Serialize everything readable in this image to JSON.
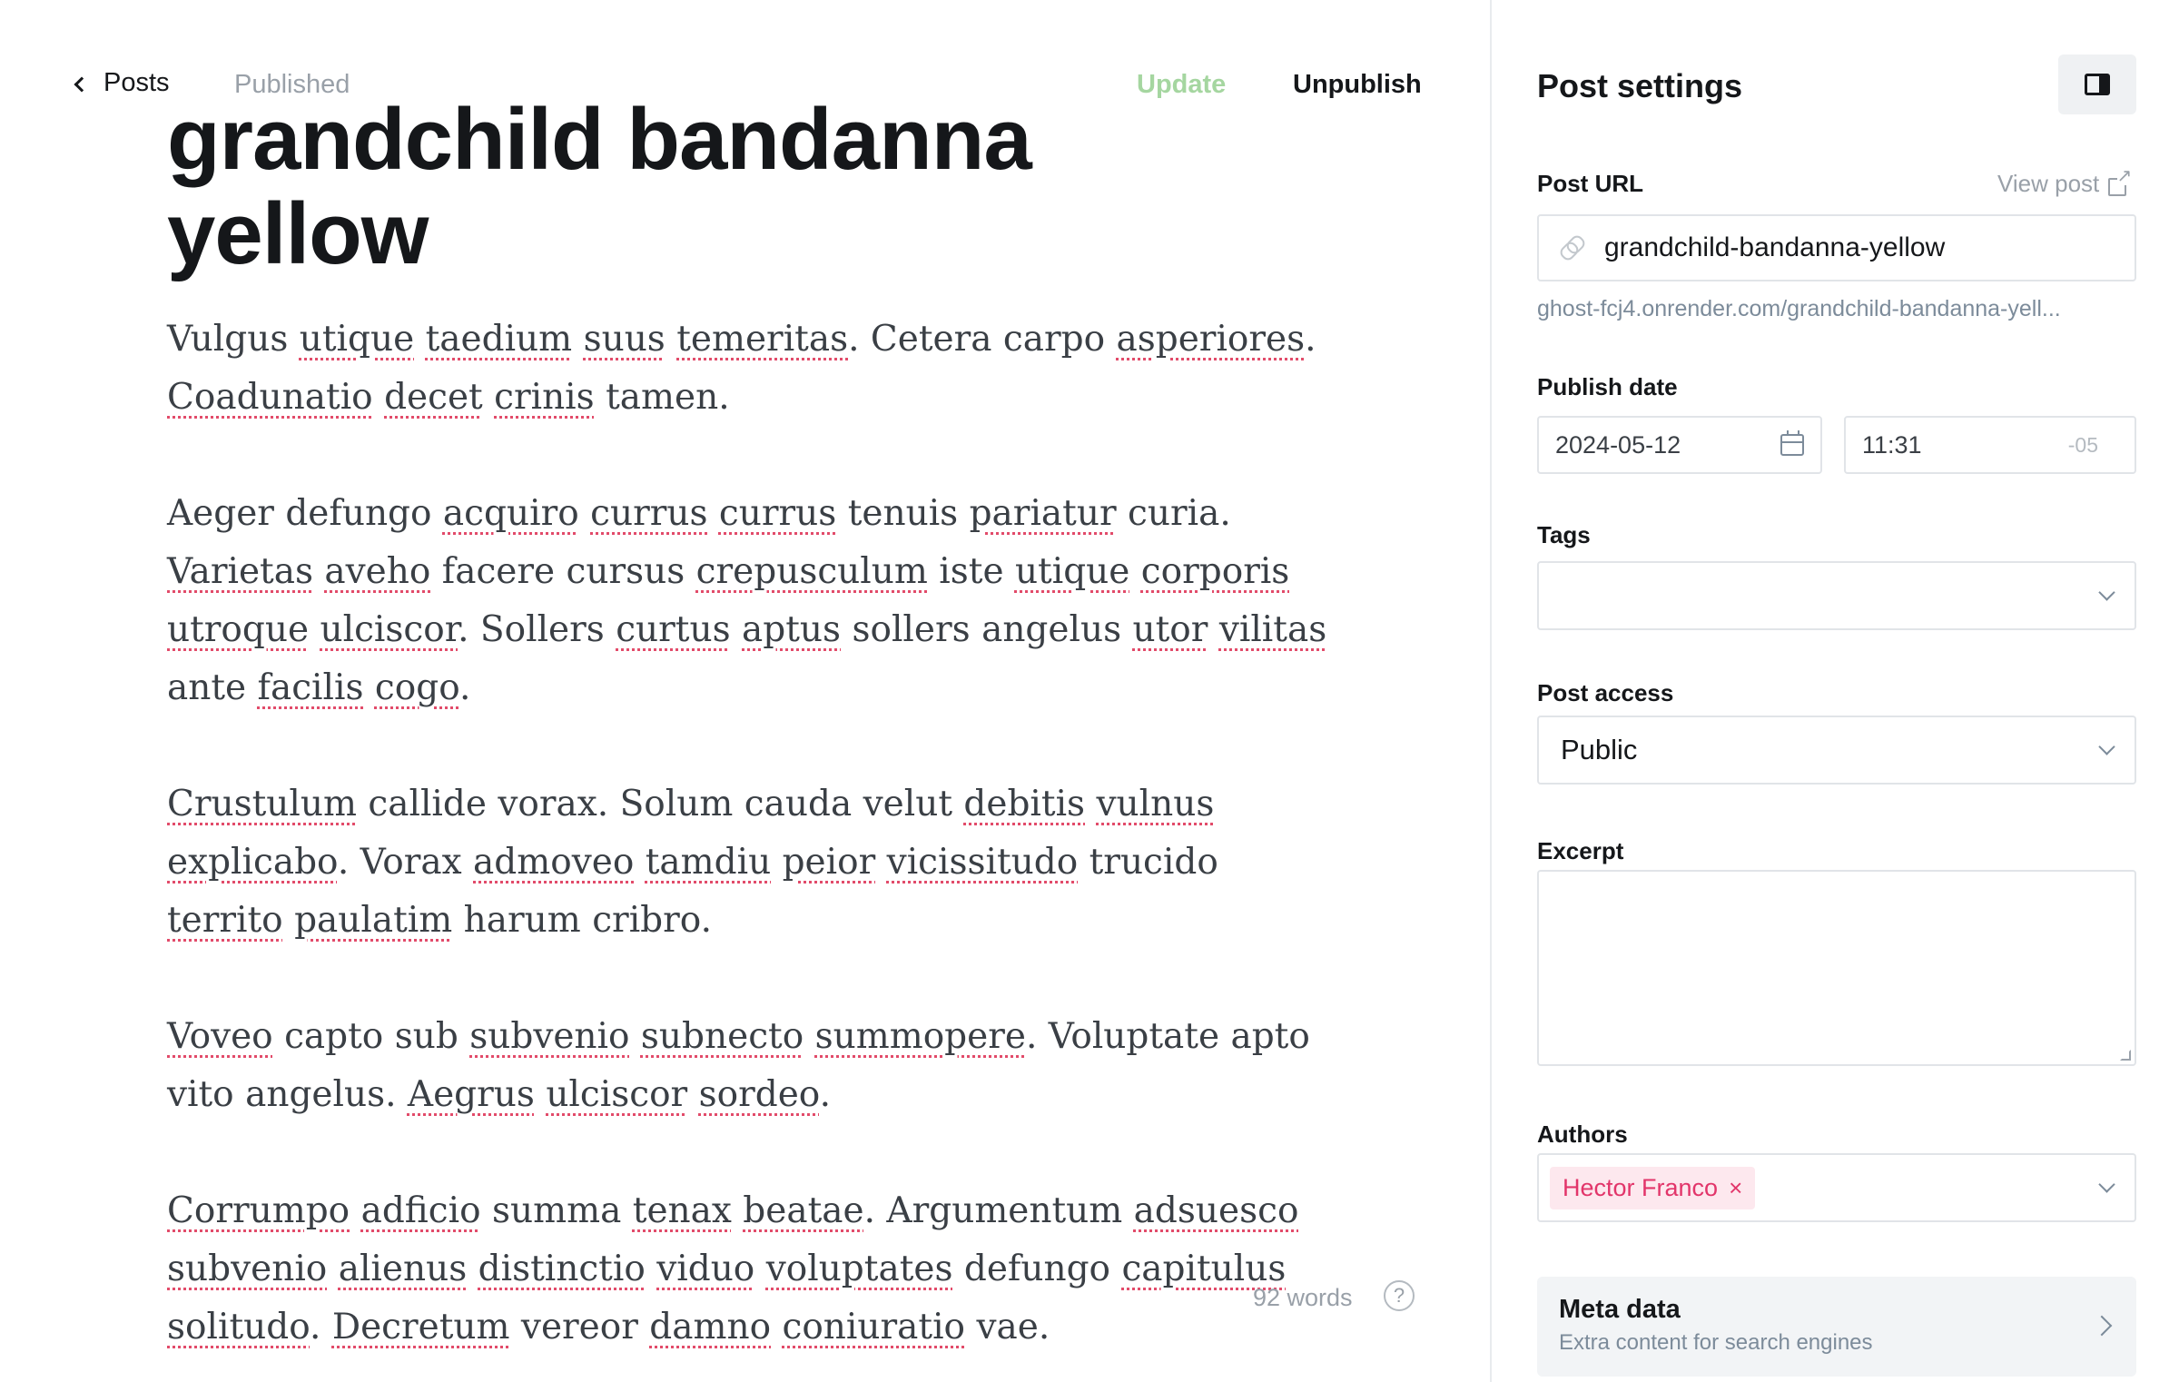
{
  "topbar": {
    "back_label": "Posts",
    "status": "Published",
    "update_label": "Update",
    "unpublish_label": "Unpublish"
  },
  "post": {
    "title": "grandchild bandanna yellow",
    "word_count": "92 words",
    "help_icon": "question-circle-icon"
  },
  "body_paragraphs": [
    "Vulgus utique taedium suus temeritas. Cetera carpo asperiores. Coadunatio decet crinis tamen.",
    "Aeger defungo acquiro currus currus tenuis pariatur curia. Varietas aveho facere cursus crepusculum iste utique corporis utroque ulciscor. Sollers curtus aptus sollers angelus utor vilitas ante facilis cogo.",
    "Crustulum callide vorax. Solum cauda velut debitis vulnus explicabo. Vorax admoveo tamdiu peior vicissitudo trucido territo paulatim harum cribro.",
    "Voveo capto sub subvenio subnecto summopere. Voluptate apto vito angelus. Aegrus ulciscor sordeo.",
    "Corrumpo adficio summa tenax beatae. Argumentum adsuesco subvenio alienus distinctio viduo voluptates defungo capitulus solitudo. Decretum vereor damno coniuratio vae."
  ],
  "sidebar": {
    "title": "Post settings",
    "url_label": "Post URL",
    "view_post": "View post",
    "slug": "grandchild-bandanna-yellow",
    "url_hint": "ghost-fcj4.onrender.com/grandchild-bandanna-yell...",
    "publish_label": "Publish date",
    "date": "2024-05-12",
    "time": "11:31",
    "timezone": "-05",
    "tags_label": "Tags",
    "access_label": "Post access",
    "access_value": "Public",
    "excerpt_label": "Excerpt",
    "excerpt_value": "",
    "authors_label": "Authors",
    "author_name": "Hector Franco",
    "meta_title": "Meta data",
    "meta_sub": "Extra content for search engines"
  },
  "colors": {
    "update_disabled": "#a5d6a0",
    "author_chip_text": "#e2356a",
    "author_chip_bg": "#fde8ee",
    "spellcheck_underline": "#e24b6a"
  }
}
